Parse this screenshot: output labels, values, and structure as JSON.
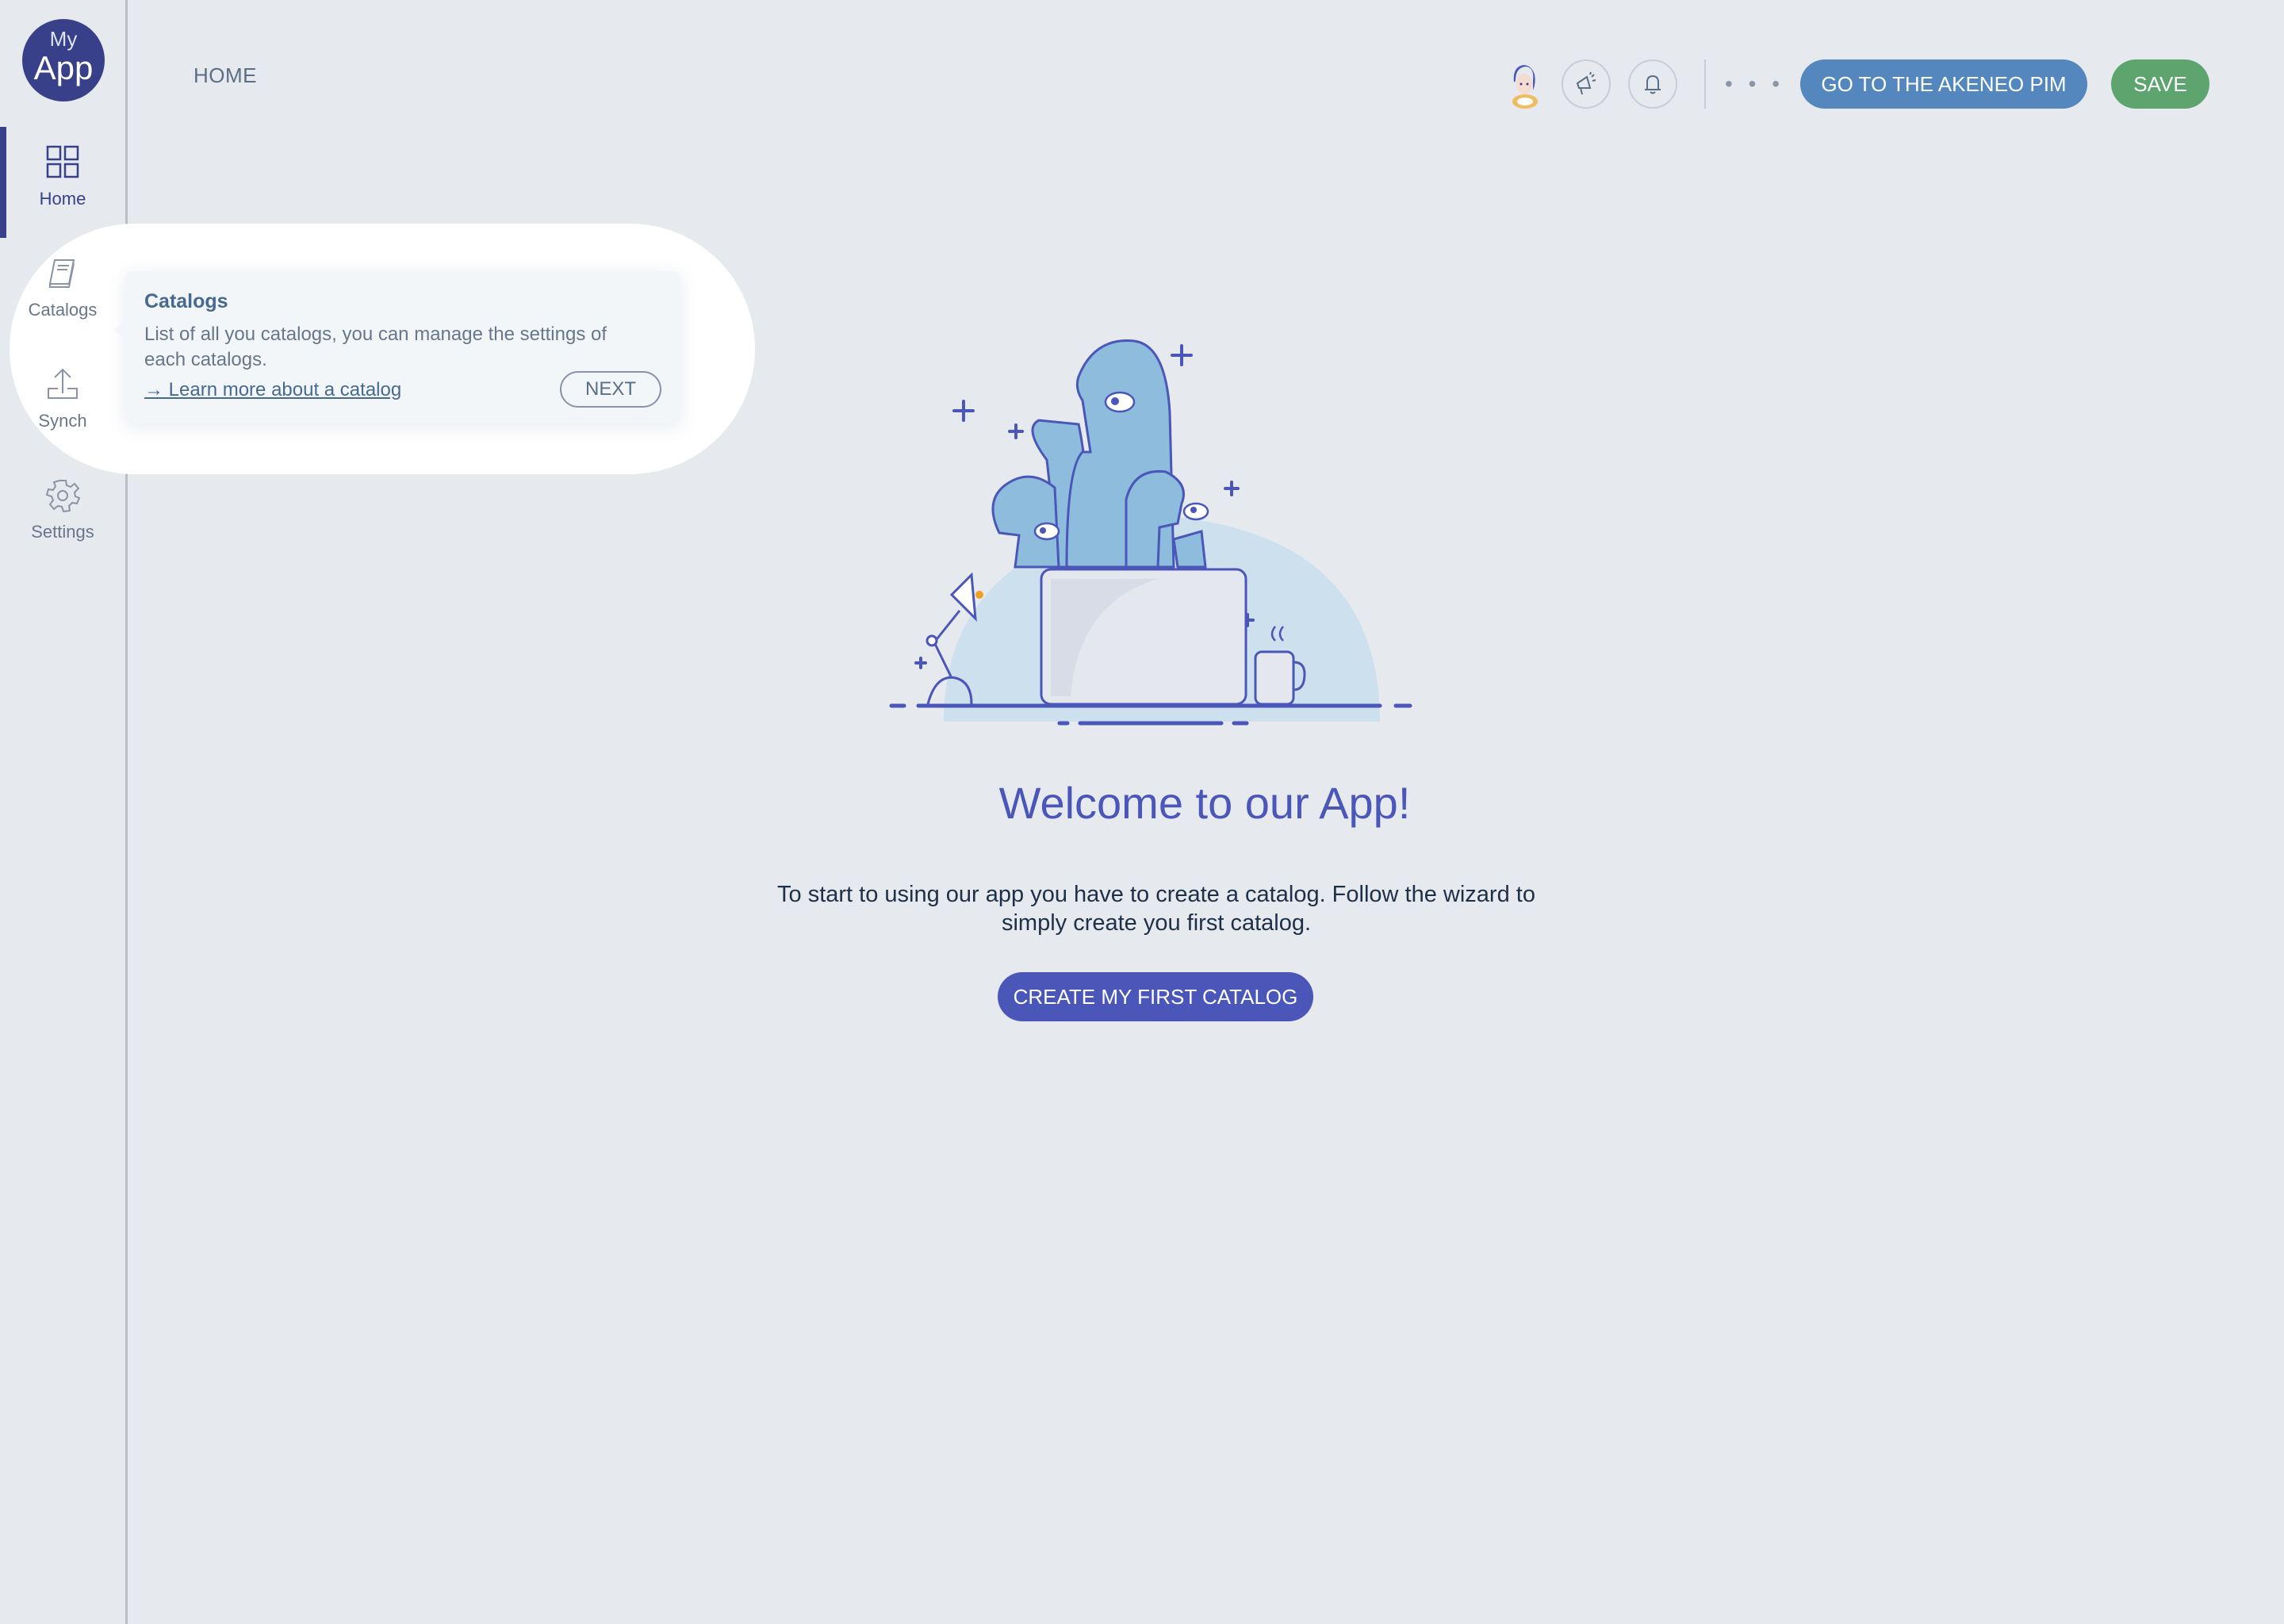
{
  "app": {
    "logo_top": "My",
    "logo_bottom": "App"
  },
  "sidebar": {
    "items": [
      {
        "label": "Home",
        "icon": "grid-icon",
        "active": true
      },
      {
        "label": "Catalogs",
        "icon": "book-icon",
        "active": false
      },
      {
        "label": "Synch",
        "icon": "upload-icon",
        "active": false
      },
      {
        "label": "Settings",
        "icon": "gear-icon",
        "active": false
      }
    ]
  },
  "header": {
    "breadcrumb": "HOME",
    "more_label": "• • •",
    "pim_button": "GO TO THE AKENEO PIM",
    "save_button": "SAVE"
  },
  "tour": {
    "title": "Catalogs",
    "body": "List of all you catalogs, you can manage the settings of each catalogs.",
    "link": "→ Learn more about a catalog",
    "next_button": "NEXT"
  },
  "main": {
    "title": "Welcome to our App!",
    "description": "To start to using our app you have to create a catalog. Follow the wizard to simply create you first catalog.",
    "cta": "CREATE MY FIRST CATALOG"
  },
  "colors": {
    "brand": "#384089",
    "accent": "#4a56b8",
    "pim": "#5387be",
    "save": "#5da46e",
    "background": "#e6eaee"
  }
}
